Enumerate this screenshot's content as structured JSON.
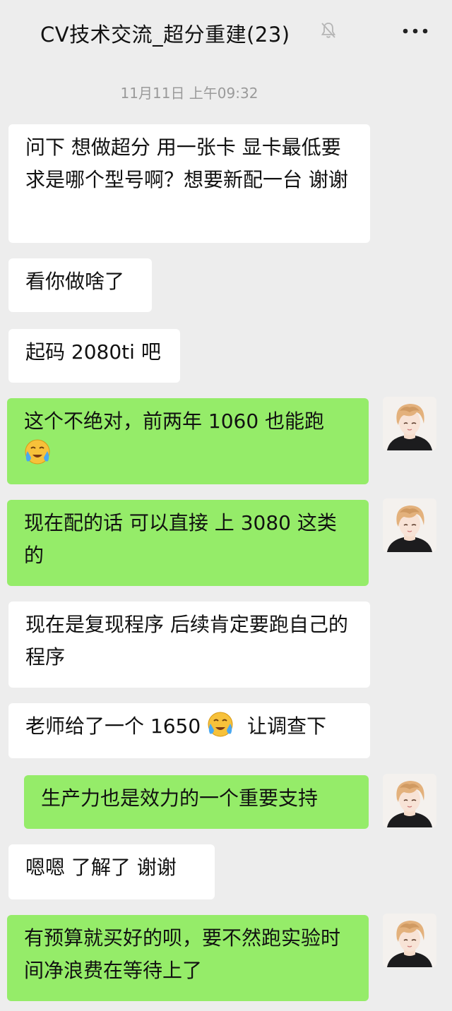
{
  "header": {
    "title": "CV技术交流_超分重建(23)",
    "muted_icon": "bell-off-icon",
    "more_icon": "more-icon"
  },
  "chat": {
    "timestamp": "11月11日 上午09:32",
    "messages": [
      {
        "side": "in",
        "text": "问下 想做超分 用一张卡  显卡最低要求是哪个型号啊？想要新配一台 谢谢"
      },
      {
        "side": "in",
        "text": "看你做啥了"
      },
      {
        "side": "in",
        "text": "起码 2080ti 吧"
      },
      {
        "side": "out",
        "text": "这个不绝对，前两年 1060 也能跑"
      },
      {
        "side": "out",
        "text": "现在配的话  可以直接  上  3080 这类的"
      },
      {
        "side": "in",
        "text": "现在是复现程序   后续肯定要跑自己的程序"
      },
      {
        "side": "in",
        "text_before": "老师给了一个 1650",
        "text_after": "让调查下"
      },
      {
        "side": "out",
        "text": "生产力也是效力的一个重要支持"
      },
      {
        "side": "in",
        "text": "嗯嗯  了解了 谢谢"
      },
      {
        "side": "out",
        "text": "有预算就买好的呗，要不然跑实验时间净浪费在等待上了"
      }
    ]
  },
  "colors": {
    "background": "#ededed",
    "incoming_bubble": "#ffffff",
    "outgoing_bubble": "#95ec69",
    "timestamp_text": "#9a9a9a"
  }
}
